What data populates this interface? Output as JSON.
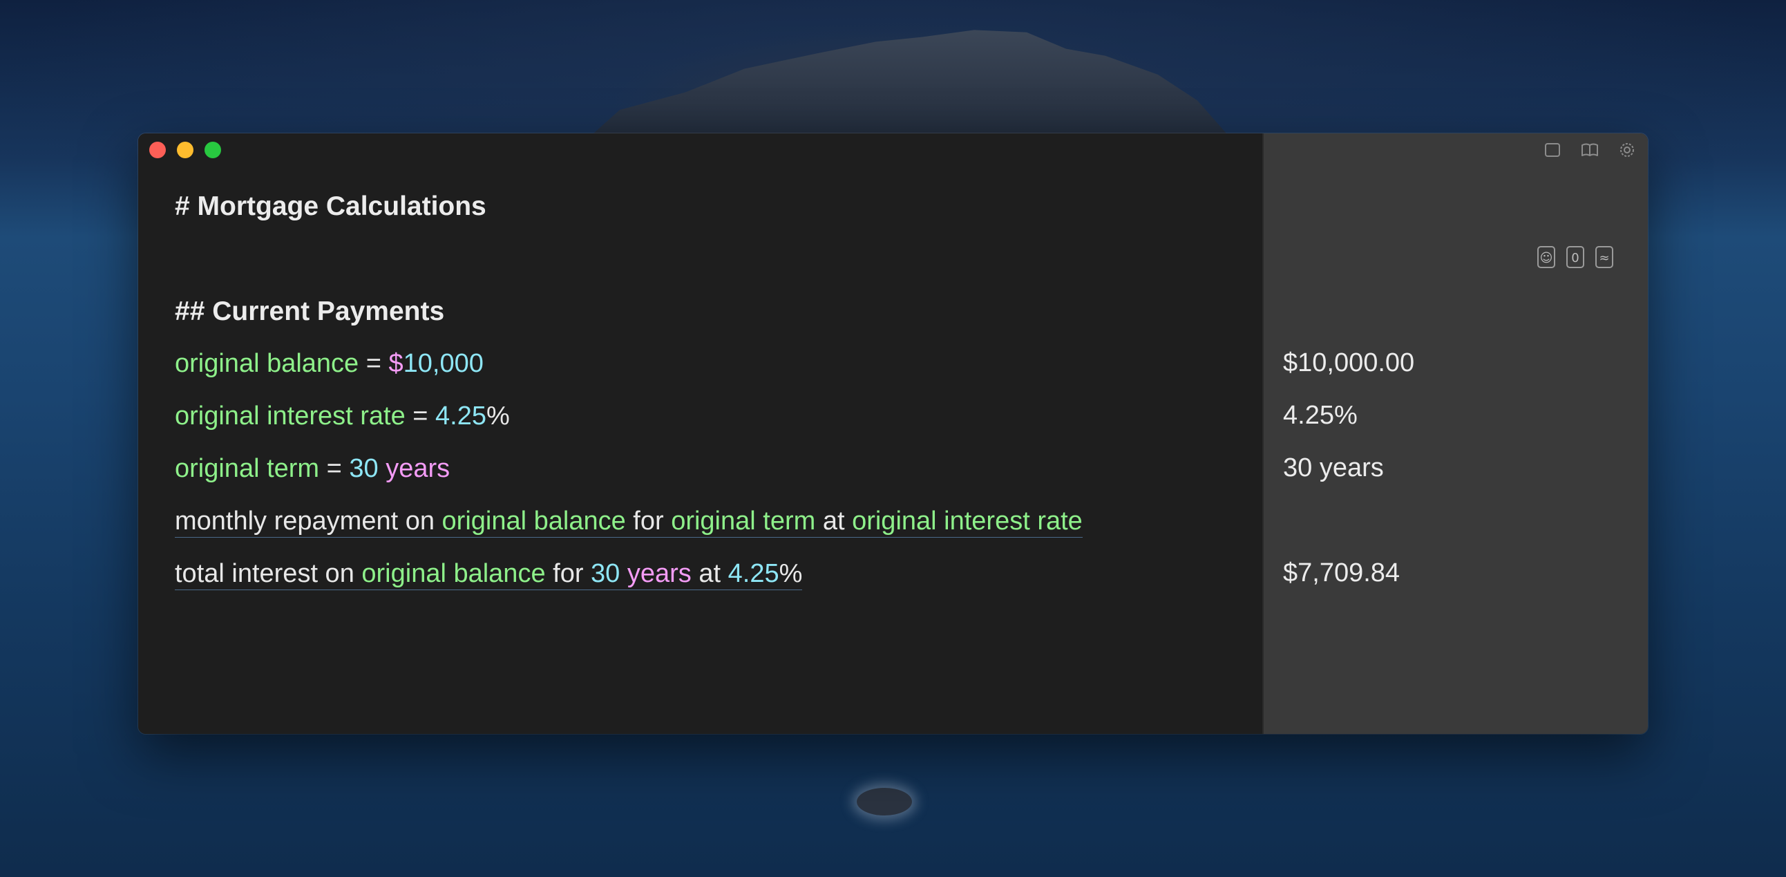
{
  "doc": {
    "heading": "# Mortgage Calculations",
    "subheading": "## Current Payments"
  },
  "lines": {
    "l1": {
      "var": "original balance",
      "op": " = ",
      "currency": "$",
      "value": "10,000"
    },
    "l2": {
      "var": "original interest rate",
      "op": " = ",
      "value": "4.25",
      "pct": "%"
    },
    "l3": {
      "var": "original term",
      "op": " = ",
      "value": "30",
      "unit": " years"
    },
    "l4": {
      "t1": "monthly repayment on ",
      "v1": "original balance",
      "t2": " for ",
      "v2": "original term",
      "t3": " at ",
      "v3": "original interest rate"
    },
    "l5": {
      "t1": "total interest on ",
      "v1": "original balance",
      "t2": " for ",
      "n1": "30",
      "u1": " years",
      "t3": " at ",
      "n2": "4.25",
      "pct": "%"
    }
  },
  "results": {
    "r1": "$10,000.00",
    "r2": "4.25%",
    "r3": "30 years",
    "r5": "$7,709.84"
  },
  "icons": {
    "top": [
      "sidebar-toggle-icon",
      "book-icon",
      "gear-icon"
    ],
    "tools": [
      "document-icon",
      "zero-icon",
      "approx-icon"
    ],
    "tool_glyphs": [
      "☺",
      "0",
      "≈"
    ]
  },
  "colors": {
    "variable": "#8ef08a",
    "number": "#8ee6f5",
    "unit": "#f49cf6",
    "editor_bg": "#1e1e1e",
    "results_bg": "#3a3a3a"
  }
}
